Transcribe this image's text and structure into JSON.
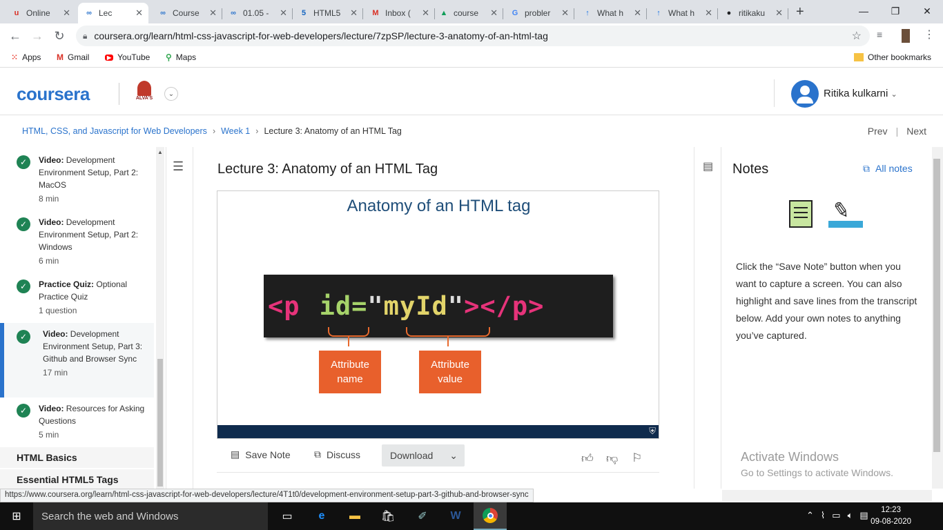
{
  "browser": {
    "tabs": [
      {
        "label": "Online",
        "icon": "u",
        "color": "#d93025"
      },
      {
        "label": "Lec",
        "icon": "∞",
        "color": "#2a73cc"
      },
      {
        "label": "Course",
        "icon": "∞",
        "color": "#2a73cc"
      },
      {
        "label": "01.05 -",
        "icon": "∞",
        "color": "#2a73cc"
      },
      {
        "label": "HTML5",
        "icon": "5",
        "color": "#1565c0"
      },
      {
        "label": "Inbox (",
        "icon": "M",
        "color": "#d93025"
      },
      {
        "label": "course",
        "icon": "▲",
        "color": "#0f9d58"
      },
      {
        "label": "probler",
        "icon": "G",
        "color": "#4285f4"
      },
      {
        "label": "What h",
        "icon": "↑",
        "color": "#1a73e8"
      },
      {
        "label": "What h",
        "icon": "↑",
        "color": "#1a73e8"
      },
      {
        "label": "ritikaku",
        "icon": "●",
        "color": "#202124"
      }
    ],
    "url": "coursera.org/learn/html-css-javascript-for-web-developers/lecture/7zpSP/lecture-3-anatomy-of-an-html-tag",
    "bookmarks": {
      "apps": "Apps",
      "gmail": "Gmail",
      "youtube": "YouTube",
      "maps": "Maps",
      "other": "Other bookmarks"
    }
  },
  "header": {
    "logo": "coursera",
    "university": "ALVA'S",
    "user": "Ritika kulkarni"
  },
  "breadcrumb": {
    "course": "HTML, CSS, and Javascript for Web Developers",
    "week": "Week 1",
    "current": "Lecture 3: Anatomy of an HTML Tag",
    "prev": "Prev",
    "next": "Next"
  },
  "sidebar": {
    "items": [
      {
        "type": "Video:",
        "title": "Development Environment Setup, Part 2: MacOS",
        "duration": "8 min"
      },
      {
        "type": "Video:",
        "title": "Development Environment Setup, Part 2: Windows",
        "duration": "6 min"
      },
      {
        "type": "Practice Quiz:",
        "title": "Optional Practice Quiz",
        "duration": "1 question"
      },
      {
        "type": "Video:",
        "title": "Development Environment Setup, Part 3: Github and Browser Sync",
        "duration": "17 min"
      },
      {
        "type": "Video:",
        "title": "Resources for Asking Questions",
        "duration": "5 min"
      }
    ],
    "sections": [
      "HTML Basics",
      "Essential HTML5 Tags"
    ]
  },
  "lecture": {
    "title": "Lecture 3: Anatomy of an HTML Tag",
    "slide_title": "Anatomy of an HTML tag",
    "code": {
      "open": "<p",
      "attr": "id=",
      "quote1": "\"",
      "value": "myId",
      "quote2": "\"",
      "close": "></p>"
    },
    "label_name": "Attribute name",
    "label_value": "Attribute value"
  },
  "actions": {
    "save": "Save Note",
    "discuss": "Discuss",
    "download": "Download"
  },
  "notes": {
    "title": "Notes",
    "all": "All notes",
    "text": "Click the “Save Note” button when you want to capture a screen. You can also highlight and save lines from the transcript below. Add your own notes to anything you’ve captured."
  },
  "activate": {
    "line1": "Activate Windows",
    "line2": "Go to Settings to activate Windows."
  },
  "status_url": "https://www.coursera.org/learn/html-css-javascript-for-web-developers/lecture/4T1t0/development-environment-setup-part-3-github-and-browser-sync",
  "taskbar": {
    "search": "Search the web and Windows",
    "time": "12:23",
    "date": "09-08-2020"
  }
}
